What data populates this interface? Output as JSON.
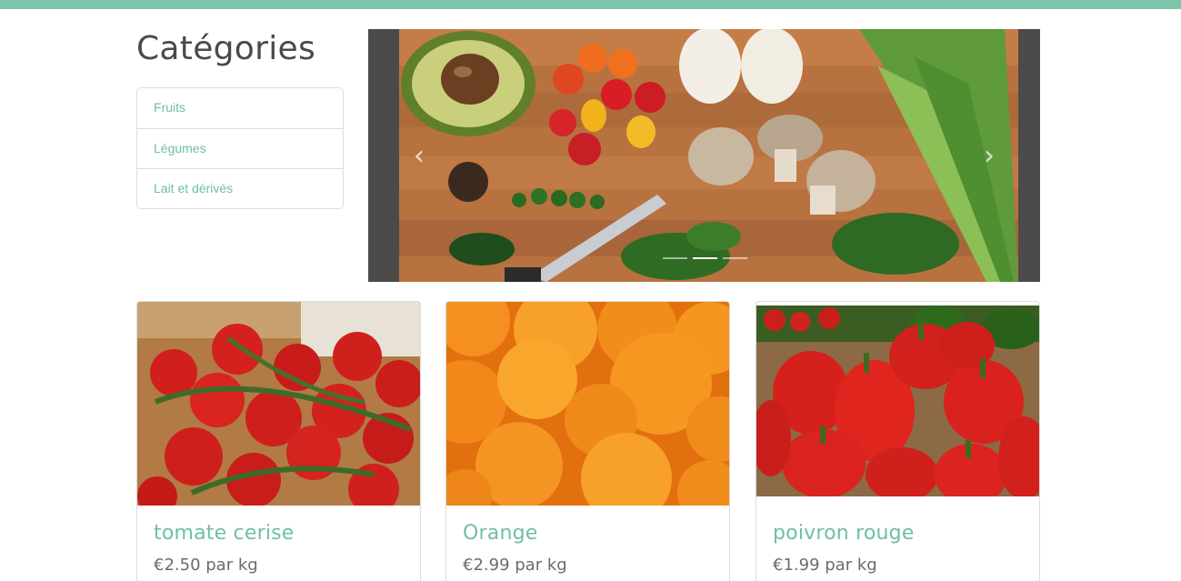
{
  "colors": {
    "accent": "#7cc5aa",
    "link": "#6fc0a2",
    "text": "#4a4a4a",
    "price": "#6b6b6b"
  },
  "sidebar": {
    "title": "Catégories",
    "items": [
      {
        "label": "Fruits"
      },
      {
        "label": "Légumes"
      },
      {
        "label": "Lait et dérivés"
      }
    ]
  },
  "carousel": {
    "prev_icon": "chevron-left-icon",
    "next_icon": "chevron-right-icon",
    "prev_glyph": "‹",
    "next_glyph": "›",
    "slide_count": 3,
    "active_slide": 2
  },
  "products": [
    {
      "name": "tomate cerise",
      "price": "€2.50 par kg",
      "image": "cherry-tomatoes"
    },
    {
      "name": "Orange",
      "price": "€2.99 par kg",
      "image": "oranges"
    },
    {
      "name": "poivron rouge",
      "price": "€1.99 par kg",
      "image": "red-peppers"
    }
  ]
}
